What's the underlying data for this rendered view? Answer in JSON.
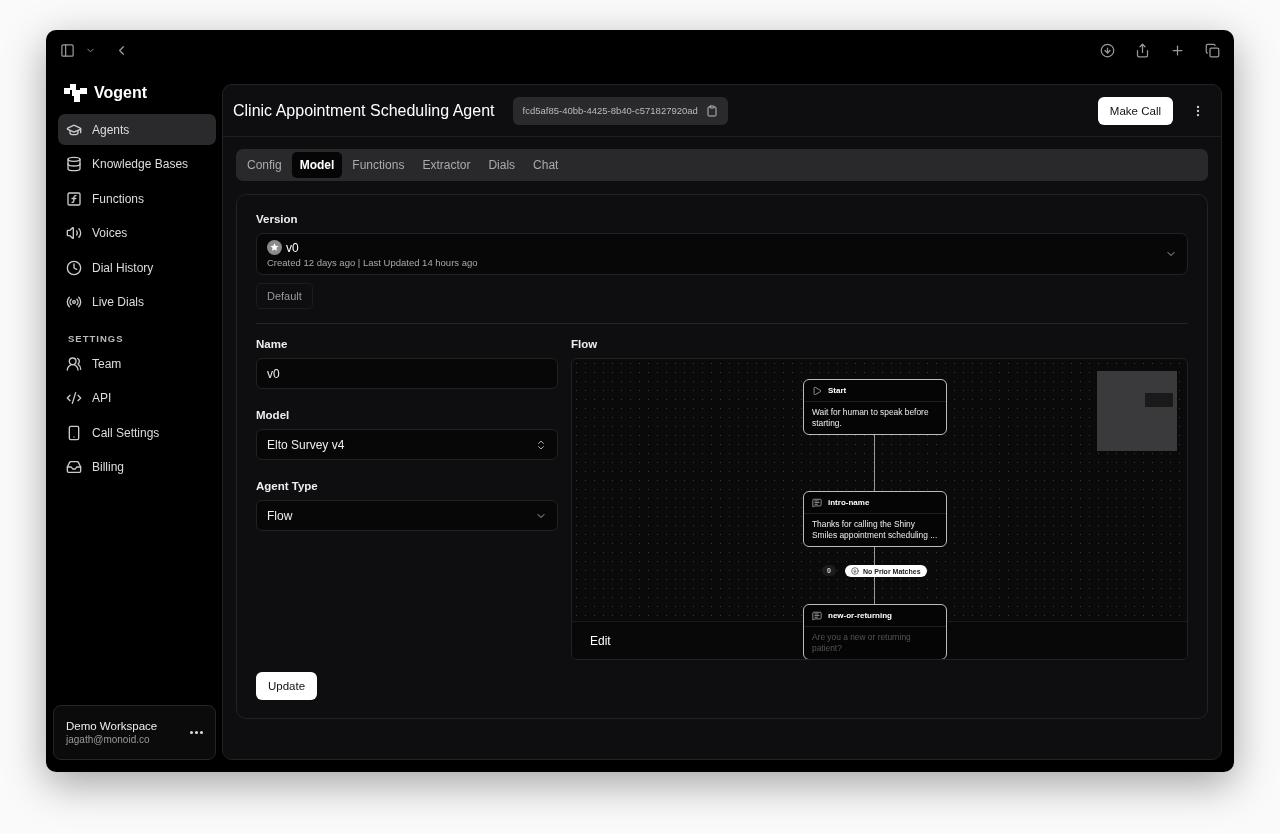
{
  "sidebar": {
    "brand": "Vogent",
    "items": [
      {
        "label": "Agents",
        "selected": true
      },
      {
        "label": "Knowledge Bases",
        "selected": false
      },
      {
        "label": "Functions",
        "selected": false
      },
      {
        "label": "Voices",
        "selected": false
      },
      {
        "label": "Dial History",
        "selected": false
      },
      {
        "label": "Live Dials",
        "selected": false
      }
    ],
    "settings_heading": "SETTINGS",
    "settings_items": [
      {
        "label": "Team",
        "selected": false
      },
      {
        "label": "API",
        "selected": false
      },
      {
        "label": "Call Settings",
        "selected": false
      },
      {
        "label": "Billing",
        "selected": false
      }
    ],
    "workspace": {
      "name": "Demo Workspace",
      "email": "jagath@monoid.co"
    }
  },
  "header": {
    "title": "Clinic Appointment Scheduling Agent",
    "agent_id": "fcd5af85-40bb-4425-8b40-c571827920ad",
    "action": "Make Call"
  },
  "tabs": [
    {
      "label": "Config",
      "selected": false
    },
    {
      "label": "Model",
      "selected": true
    },
    {
      "label": "Functions",
      "selected": false
    },
    {
      "label": "Extractor",
      "selected": false
    },
    {
      "label": "Dials",
      "selected": false
    },
    {
      "label": "Chat",
      "selected": false
    }
  ],
  "version": {
    "label": "Version",
    "value": "v0",
    "meta": "Created 12 days ago | Last Updated 14 hours ago",
    "badge": "Default"
  },
  "fields": [
    {
      "label": "Name",
      "kind": "text",
      "value": "v0"
    },
    {
      "label": "Model",
      "kind": "stepper",
      "value": "Elto Survey v4"
    },
    {
      "label": "Agent Type",
      "kind": "dropdown",
      "value": "Flow"
    }
  ],
  "submit": "Update",
  "flow": {
    "label": "Flow",
    "edit": "Edit",
    "nodes": [
      {
        "kind": "start",
        "title": "Start",
        "body": "Wait for human to speak before starting."
      },
      {
        "kind": "message",
        "title": "intro-name",
        "body": "Thanks for calling the Shiny Smiles appointment scheduling ...",
        "out_count": "0",
        "out_label": "No Prior Matches"
      },
      {
        "kind": "message",
        "title": "new-or-returning",
        "body": "Are you a new or returning patient?"
      }
    ]
  }
}
